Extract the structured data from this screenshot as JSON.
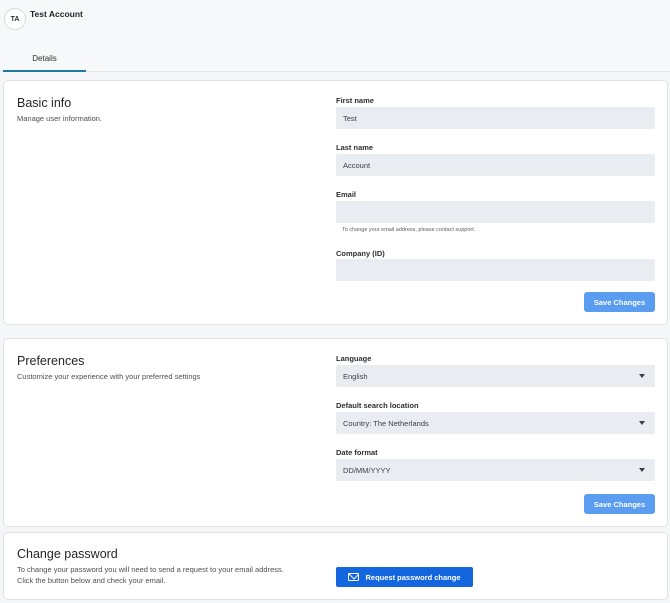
{
  "header": {
    "avatar_initials": "TA",
    "account_name": "Test Account",
    "tabs": [
      {
        "label": "Details",
        "active": true
      }
    ]
  },
  "basic_info": {
    "title": "Basic info",
    "description": "Manage user information.",
    "first_name_label": "First name",
    "first_name_value": "Test",
    "last_name_label": "Last name",
    "last_name_value": "Account",
    "email_label": "Email",
    "email_value": "",
    "email_help": "To change your email address, please contact support.",
    "company_label": "Company (ID)",
    "company_value": "",
    "save_label": "Save Changes"
  },
  "preferences": {
    "title": "Preferences",
    "description": "Customize your experience with your preferred settings",
    "language_label": "Language",
    "language_value": "English",
    "search_location_label": "Default search location",
    "search_location_value": "Country: The Netherlands",
    "date_format_label": "Date format",
    "date_format_value": "DD/MM/YYYY",
    "save_label": "Save Changes"
  },
  "change_password": {
    "title": "Change password",
    "description_line1": "To change your password you will need to send a request to your email address.",
    "description_line2": "Click the button below and check your email.",
    "button_label": "Request password change",
    "button_icon": "mail-icon"
  },
  "colors": {
    "accent": "#1466de",
    "save_button": "#5a9df0",
    "tab_underline": "#1c7aa3"
  }
}
